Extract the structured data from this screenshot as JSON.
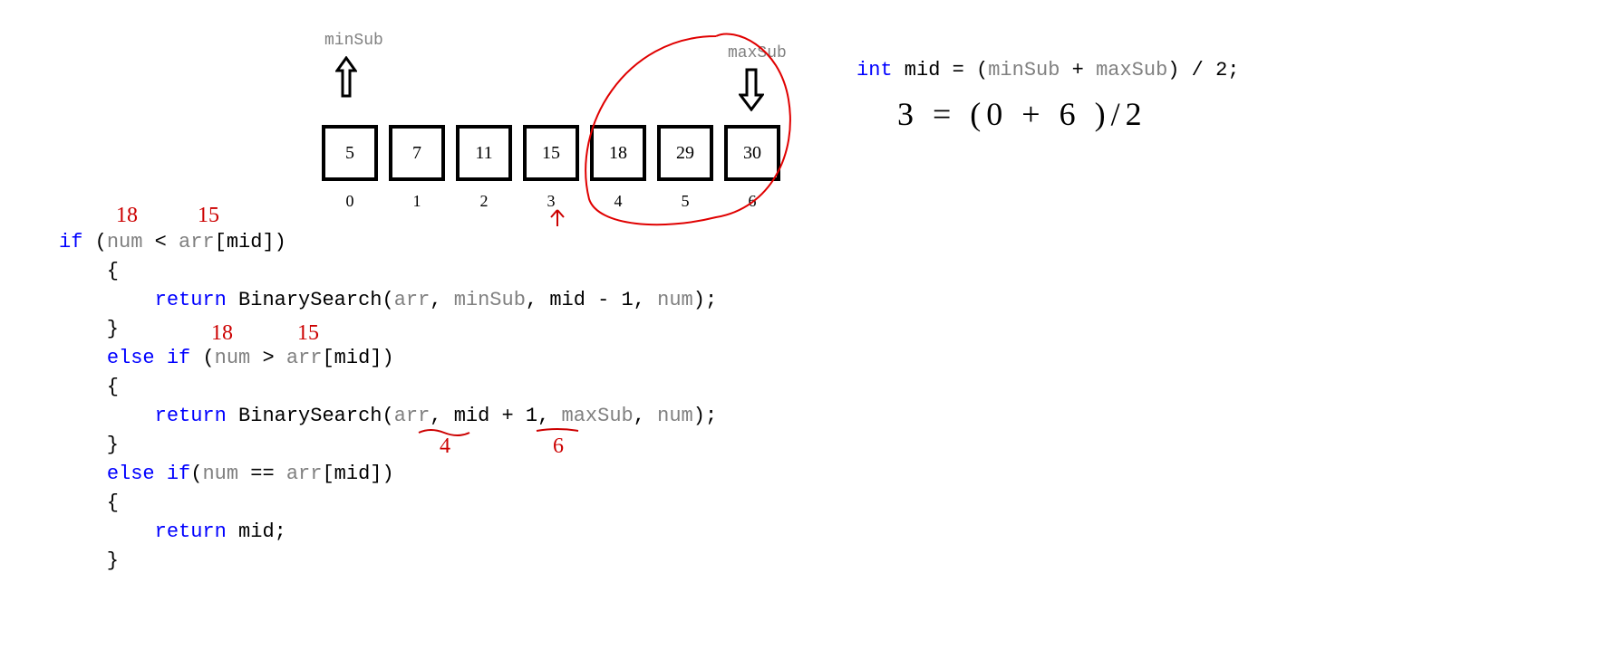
{
  "labels": {
    "minSub": "minSub",
    "maxSub": "maxSub"
  },
  "array": {
    "values": [
      "5",
      "7",
      "11",
      "15",
      "18",
      "29",
      "30"
    ],
    "indices": [
      "0",
      "1",
      "2",
      "3",
      "4",
      "5",
      "6"
    ]
  },
  "code_left": {
    "l1_if": "if",
    "l1_open": " (",
    "l1_num": "num",
    "l1_lt": " < ",
    "l1_arr": "arr",
    "l1_br_open": "[",
    "l1_mid": "mid",
    "l1_br_close": "])",
    "l2": "    {",
    "l3_indent": "        ",
    "l3_return": "return",
    "l3_space": " ",
    "l3_fn": "BinarySearch",
    "l3_open": "(",
    "l3_arr": "arr",
    "l3_c1": ", ",
    "l3_minSub": "minSub",
    "l3_c2": ", ",
    "l3_midm1": "mid - 1",
    "l3_c3": ", ",
    "l3_num": "num",
    "l3_close": ");",
    "l4": "    }",
    "l5_indent": "    ",
    "l5_else": "else if",
    "l5_open": " (",
    "l5_num": "num",
    "l5_gt": " > ",
    "l5_arr": "arr",
    "l5_br_open": "[",
    "l5_mid": "mid",
    "l5_br_close": "])",
    "l6": "    {",
    "l7_indent": "        ",
    "l7_return": "return",
    "l7_space": " ",
    "l7_fn": "BinarySearch",
    "l7_open": "(",
    "l7_arr": "arr",
    "l7_c1": ", ",
    "l7_midp1": "mid + 1",
    "l7_c2": ", ",
    "l7_maxSub": "maxSub",
    "l7_c3": ", ",
    "l7_num": "num",
    "l7_close": ");",
    "l8": "    }",
    "l9_indent": "    ",
    "l9_else": "else if",
    "l9_open": "(",
    "l9_num": "num",
    "l9_eq": " == ",
    "l9_arr": "arr",
    "l9_br_open": "[",
    "l9_mid": "mid",
    "l9_br_close": "])",
    "l10": "    {",
    "l11_indent": "        ",
    "l11_return": "return",
    "l11_space": " ",
    "l11_mid": "mid",
    "l11_semi": ";",
    "l12": "    }"
  },
  "code_right": {
    "int": "int",
    "mid_eq": " mid = (",
    "minSub": "minSub",
    "plus": " + ",
    "maxSub": "maxSub",
    "rest": ") / 2;"
  },
  "handwriting": {
    "red_18_top": "18",
    "red_15_top": "15",
    "red_18_mid": "18",
    "red_15_mid": "15",
    "red_4": "4",
    "red_6": "6",
    "red_arrow_under_3": "⬆",
    "black_calc": "3 = (0 + 6 )/2"
  }
}
